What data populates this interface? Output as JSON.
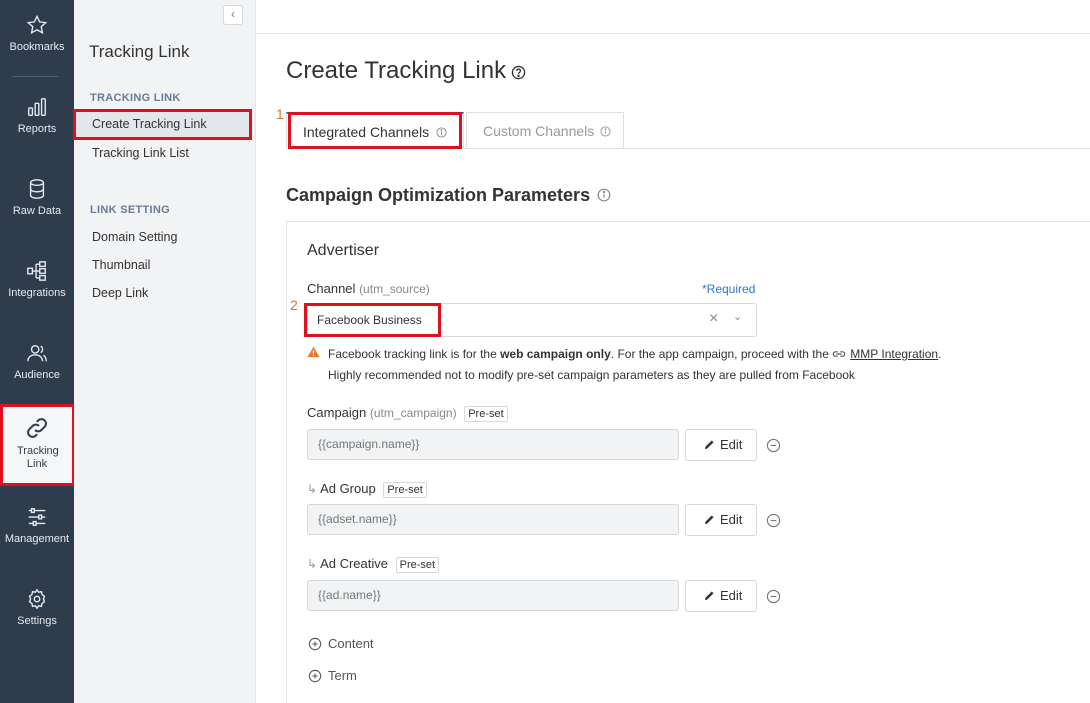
{
  "rail": {
    "items": [
      {
        "label": "Bookmarks",
        "icon": "star-icon"
      },
      {
        "label": "Reports",
        "icon": "bar-chart-icon"
      },
      {
        "label": "Raw Data",
        "icon": "database-icon"
      },
      {
        "label": "Integrations",
        "icon": "integrations-icon"
      },
      {
        "label": "Audience",
        "icon": "audience-icon"
      },
      {
        "label": "Tracking Link",
        "icon": "link-icon"
      },
      {
        "label": "Management",
        "icon": "sliders-icon"
      },
      {
        "label": "Settings",
        "icon": "gear-icon"
      }
    ]
  },
  "sidebar": {
    "collapse_icon": "‹",
    "title": "Tracking Link",
    "section1": "TRACKING LINK",
    "section1_items": [
      "Create Tracking Link",
      "Tracking Link List"
    ],
    "section2": "LINK SETTING",
    "section2_items": [
      "Domain Setting",
      "Thumbnail",
      "Deep Link"
    ]
  },
  "main": {
    "title": "Create Tracking Link",
    "tabs": [
      {
        "label": "Integrated Channels",
        "active": true
      },
      {
        "label": "Custom Channels",
        "active": false
      }
    ],
    "annotation_1": "1",
    "annotation_2": "2",
    "section_title": "Campaign Optimization Parameters",
    "panel_title": "Advertiser",
    "channel": {
      "label": "Channel",
      "sub": "(utm_source)",
      "required": "*Required",
      "value": "Facebook Business"
    },
    "warning": {
      "line1_a": "Facebook tracking link is for the ",
      "line1_bold": "web campaign only",
      "line1_b": ". For the app campaign, proceed with the ",
      "line1_link": "MMP Integration",
      "line1_c": ".",
      "line2": "Highly recommended not to modify pre-set campaign parameters as they are pulled from Facebook"
    },
    "campaign": {
      "label": "Campaign",
      "sub": "(utm_campaign)",
      "tag": "Pre-set",
      "value": "{{campaign.name}}",
      "edit": "Edit"
    },
    "ad_group": {
      "arrow": "↳",
      "label": "Ad Group",
      "tag": "Pre-set",
      "value": "{{adset.name}}",
      "edit": "Edit"
    },
    "ad_creative": {
      "arrow": "↳",
      "label": "Ad Creative",
      "tag": "Pre-set",
      "value": "{{ad.name}}",
      "edit": "Edit"
    },
    "content_label": "Content",
    "term_label": "Term"
  },
  "colors": {
    "rail_bg": "#2f3c4b",
    "highlight": "#e0111e",
    "accent": "#2d76d2",
    "annotation": "#e0761c",
    "warning": "#e8762b"
  }
}
